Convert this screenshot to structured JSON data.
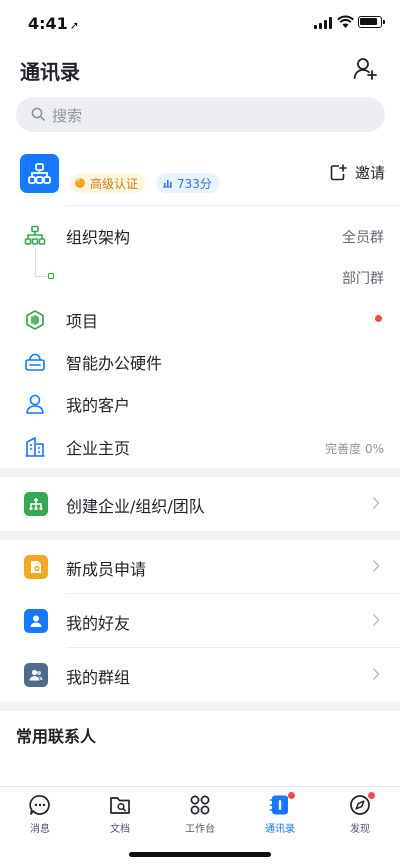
{
  "status_bar": {
    "time": "4:41",
    "location_glyph": "➚"
  },
  "header": {
    "title": "通讯录",
    "add_contact_icon": "person-add-icon"
  },
  "search": {
    "placeholder": "搜索"
  },
  "org": {
    "cert_label": "高级认证",
    "score_label": "733分",
    "invite_label": "邀请",
    "logo_icon": "org-tree-icon"
  },
  "org_menu": [
    {
      "label": "组织架构",
      "right": "全员群",
      "icon": "org-structure-icon"
    },
    {
      "label": "",
      "right": "部门群",
      "icon": "sub-department-node"
    },
    {
      "label": "项目",
      "right": "",
      "icon": "project-icon",
      "has_dot": true
    },
    {
      "label": "智能办公硬件",
      "right": "",
      "icon": "smart-hardware-icon"
    },
    {
      "label": "我的客户",
      "right": "",
      "icon": "customer-icon"
    },
    {
      "label": "企业主页",
      "right": "完善度 0%",
      "icon": "enterprise-building-icon"
    }
  ],
  "create_row": {
    "label": "创建企业/组织/团队",
    "icon": "create-org-icon",
    "color": "#34a853"
  },
  "contacts_rows": [
    {
      "label": "新成员申请",
      "icon": "new-member-icon",
      "color": "#f5a623"
    },
    {
      "label": "我的好友",
      "icon": "friend-icon",
      "color": "#1677ff"
    },
    {
      "label": "我的群组",
      "icon": "group-icon",
      "color": "#4e6a8c"
    }
  ],
  "frequent": {
    "title": "常用联系人"
  },
  "tabs": [
    {
      "label": "消息",
      "icon": "message-icon",
      "active": false
    },
    {
      "label": "文档",
      "icon": "document-folder-icon",
      "active": false
    },
    {
      "label": "工作台",
      "icon": "workbench-grid-icon",
      "active": false
    },
    {
      "label": "通讯录",
      "icon": "contacts-book-icon",
      "active": true
    },
    {
      "label": "发现",
      "icon": "compass-icon",
      "active": false
    }
  ],
  "colors": {
    "accent": "#1677ff",
    "badge_red": "#f54a45",
    "green": "#34a853"
  }
}
